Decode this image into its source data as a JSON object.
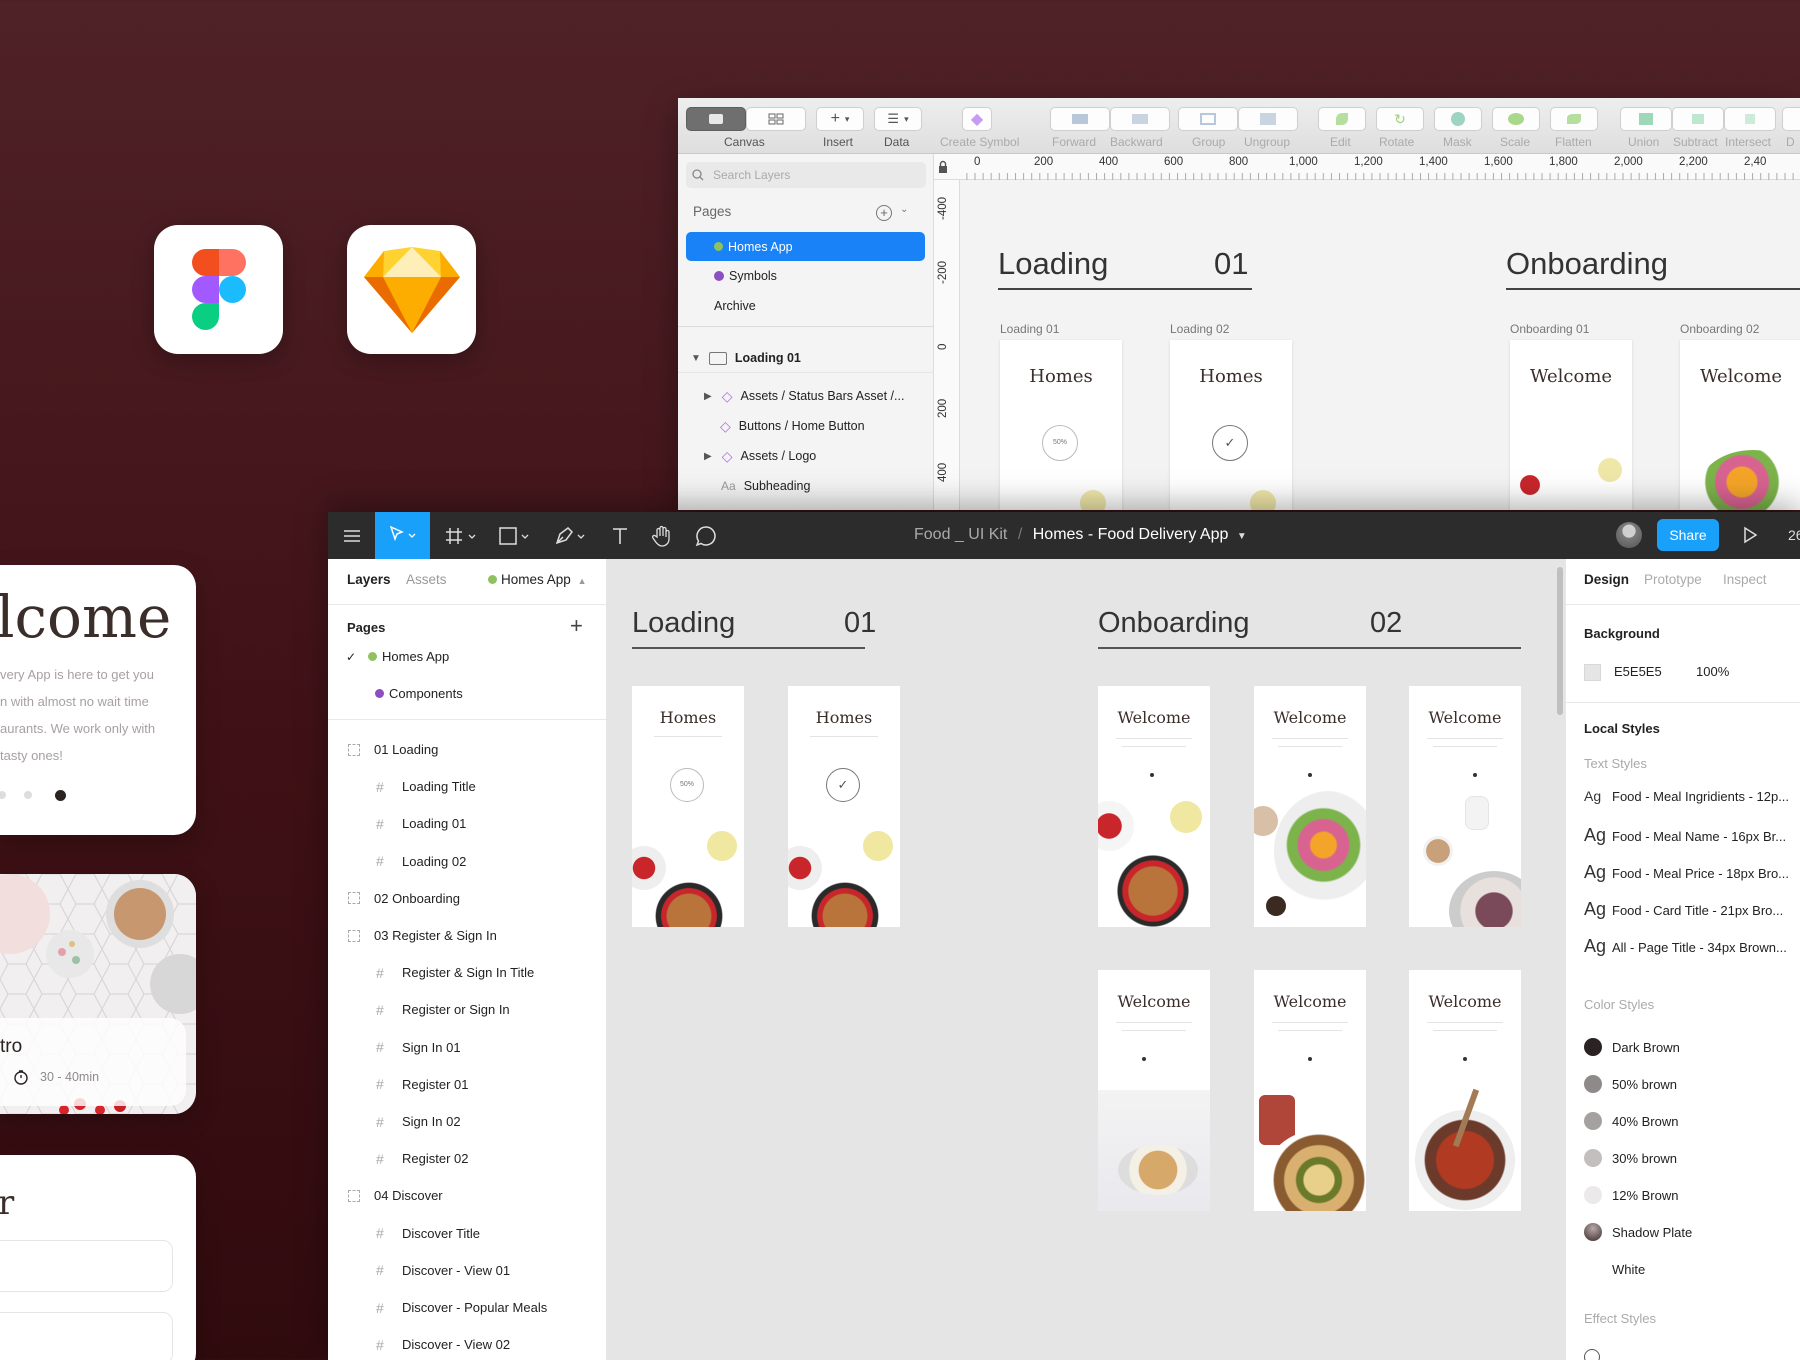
{
  "app_icons": [
    {
      "name": "figma"
    },
    {
      "name": "sketch"
    }
  ],
  "preview": {
    "welcome_title": "lcome",
    "welcome_lines": [
      "very App is here to get you",
      "n with almost no wait time",
      "aurants. We work only with",
      " tasty ones!"
    ],
    "bistro_title": "tro",
    "bistro_time": "30 - 40min",
    "register_title": "r"
  },
  "sketch": {
    "toolbar": {
      "canvas": "Canvas",
      "insert": "Insert",
      "data": "Data",
      "create_symbol": "Create Symbol",
      "forward": "Forward",
      "backward": "Backward",
      "group": "Group",
      "ungroup": "Ungroup",
      "edit": "Edit",
      "rotate": "Rotate",
      "mask": "Mask",
      "scale": "Scale",
      "flatten": "Flatten",
      "union": "Union",
      "subtract": "Subtract",
      "intersect": "Intersect",
      "difference": "D"
    },
    "search_placeholder": "Search Layers",
    "pages_label": "Pages",
    "pages": [
      "Homes App",
      "Symbols",
      "Archive"
    ],
    "layer_group": "Loading 01",
    "layers": [
      "Assets / Status Bars Asset /...",
      "Buttons / Home Button",
      "Assets / Logo",
      "Subheading"
    ],
    "ruler_top": [
      "0",
      "200",
      "400",
      "600",
      "800",
      "1,000",
      "1,200",
      "1,400",
      "1,600",
      "1,800",
      "2,000",
      "2,200",
      "2,40"
    ],
    "ruler_left": [
      "-400",
      "-200",
      "0",
      "200",
      "400"
    ],
    "sections": [
      {
        "title": "Loading",
        "number": "01"
      },
      {
        "title": "Onboarding",
        "number": ""
      }
    ],
    "artboards": [
      "Loading 01",
      "Loading 02",
      "Onboarding 01",
      "Onboarding 02"
    ],
    "homes_text": "Homes",
    "welcome_text": "Welcome",
    "loading_percent": "50%"
  },
  "figma": {
    "breadcrumb_project": "Food _ UI Kit",
    "breadcrumb_separator": "/",
    "file_name": "Homes - Food Delivery App",
    "share_label": "Share",
    "zoom_partial": "26",
    "tabs": {
      "layers": "Layers",
      "assets": "Assets",
      "page": "Homes App"
    },
    "pages_label": "Pages",
    "pages": [
      "Homes App",
      "Components"
    ],
    "layers": [
      {
        "label": "01 Loading",
        "type": "section"
      },
      {
        "label": "Loading Title",
        "type": "frame"
      },
      {
        "label": "Loading 01",
        "type": "frame"
      },
      {
        "label": "Loading 02",
        "type": "frame"
      },
      {
        "label": "02 Onboarding",
        "type": "section"
      },
      {
        "label": "03 Register & Sign In",
        "type": "section"
      },
      {
        "label": "Register & Sign In Title",
        "type": "frame"
      },
      {
        "label": "Register or Sign In",
        "type": "frame"
      },
      {
        "label": "Sign In 01",
        "type": "frame"
      },
      {
        "label": "Register 01",
        "type": "frame"
      },
      {
        "label": "Sign In 02",
        "type": "frame"
      },
      {
        "label": "Register 02",
        "type": "frame"
      },
      {
        "label": "04 Discover",
        "type": "section"
      },
      {
        "label": "Discover Title",
        "type": "frame"
      },
      {
        "label": "Discover - View 01",
        "type": "frame"
      },
      {
        "label": "Discover - Popular Meals",
        "type": "frame"
      },
      {
        "label": "Discover - View 02",
        "type": "frame"
      }
    ],
    "canvas": {
      "sections": [
        {
          "title": "Loading",
          "number": "01"
        },
        {
          "title": "Onboarding",
          "number": "02"
        }
      ],
      "homes_text": "Homes",
      "welcome_text": "Welcome",
      "loading_percent": "50%"
    },
    "right_tabs": {
      "design": "Design",
      "prototype": "Prototype",
      "inspect": "Inspect"
    },
    "background_label": "Background",
    "background_hex": "E5E5E5",
    "background_opacity": "100%",
    "local_styles": "Local Styles",
    "text_styles_label": "Text Styles",
    "text_styles": [
      "Food - Meal Ingridients - 12p...",
      "Food - Meal Name - 16px Br...",
      "Food - Meal Price - 18px Bro...",
      "Food - Card Title - 21px Bro...",
      "All - Page Title - 34px Brown..."
    ],
    "text_style_glyph": "Ag",
    "color_styles_label": "Color Styles",
    "color_styles": [
      {
        "name": "Dark Brown",
        "color": "#2b2222"
      },
      {
        "name": "50% brown",
        "color": "#8f8a8a"
      },
      {
        "name": "40% Brown",
        "color": "#a6a1a1"
      },
      {
        "name": "30% brown",
        "color": "#c3bfbf"
      },
      {
        "name": "12% Brown",
        "color": "#ebe9e9"
      },
      {
        "name": "Shadow Plate",
        "color": "#6b5a5a"
      },
      {
        "name": "White",
        "color": "#ffffff"
      }
    ],
    "effect_styles_label": "Effect Styles"
  }
}
